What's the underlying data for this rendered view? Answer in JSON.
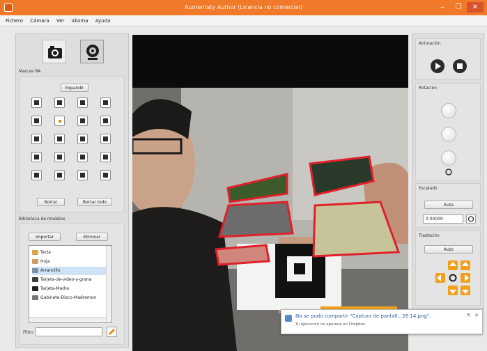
{
  "window": {
    "title": "Aumentaty Author (Licencia no comercial)",
    "minimize": "‒",
    "restore": "❐",
    "close": "✕"
  },
  "menu": [
    "Fichero",
    "Cámara",
    "Ver",
    "Idioma",
    "Ayuda"
  ],
  "left_panel": {
    "camera_icons": [
      "camera-icon",
      "webcam-icon"
    ],
    "markers_label": "Marcas RA",
    "position_button": "Expandir",
    "delete_button": "Borrar",
    "delete_all_button": "Borrar todo",
    "library_label": "Biblioteca de modelos",
    "import_button": "Importar",
    "delete_model_button": "Eliminar",
    "models": [
      "Tecla",
      "Hoja",
      "Arrancillo",
      "Tarjeta-de-video-y-grana",
      "Tarjeta-Madre",
      "Gabinete-Disco-Madremon"
    ],
    "search_label": "Filtro",
    "search_value": ""
  },
  "right_panel": {
    "animation_label": "Animación",
    "rotation_label": "Rotación",
    "scale_label": "Escalado",
    "scale_auto": "Auto",
    "scale_value": "0.00000",
    "translation_label": "Traslación",
    "translation_auto": "Auto"
  },
  "notification": {
    "title": "No se pudo compartir \"Captura de pantall...26.14.png\".",
    "body": "Tu ejecución no aparece en Dropbox.",
    "close": "✕",
    "pin": "⇱"
  },
  "colors": {
    "titlebar": "#f07a2a",
    "accent": "#f2a01c",
    "selection_outline": "#e0202a"
  }
}
